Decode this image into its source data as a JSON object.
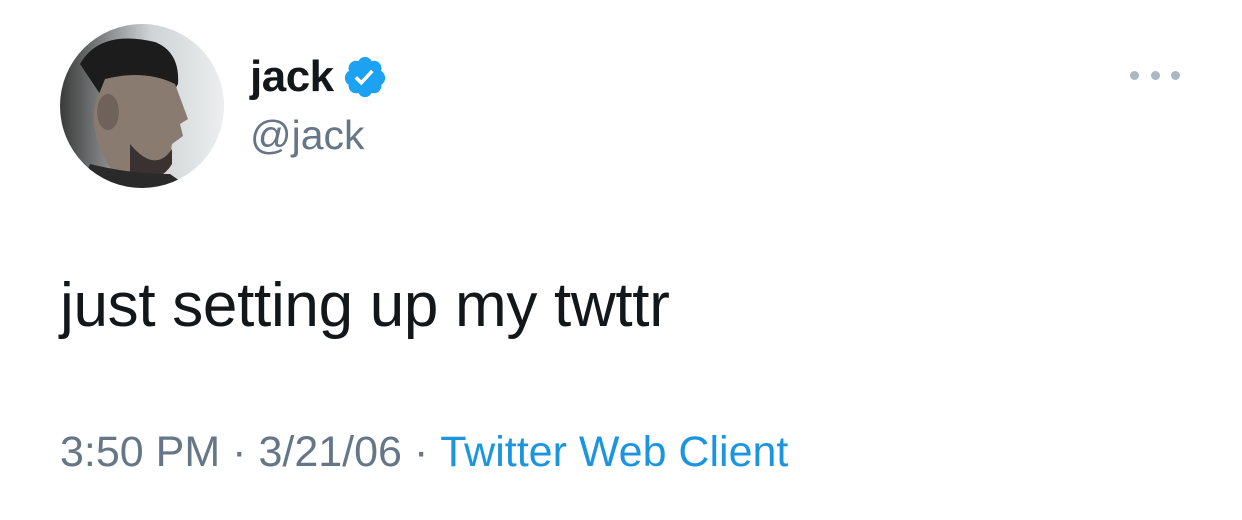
{
  "author": {
    "display_name": "jack",
    "handle": "@jack",
    "verified": true
  },
  "tweet": {
    "text": "just setting up my twttr"
  },
  "meta": {
    "time": "3:50 PM",
    "separator": "·",
    "date": "3/21/06",
    "client": "Twitter Web Client"
  },
  "icons": {
    "verified": "verified-badge-icon",
    "more": "more-options-icon"
  },
  "colors": {
    "verified": "#1da1f2",
    "link": "#1b95e0",
    "secondary": "#657786",
    "text": "#14171a"
  }
}
